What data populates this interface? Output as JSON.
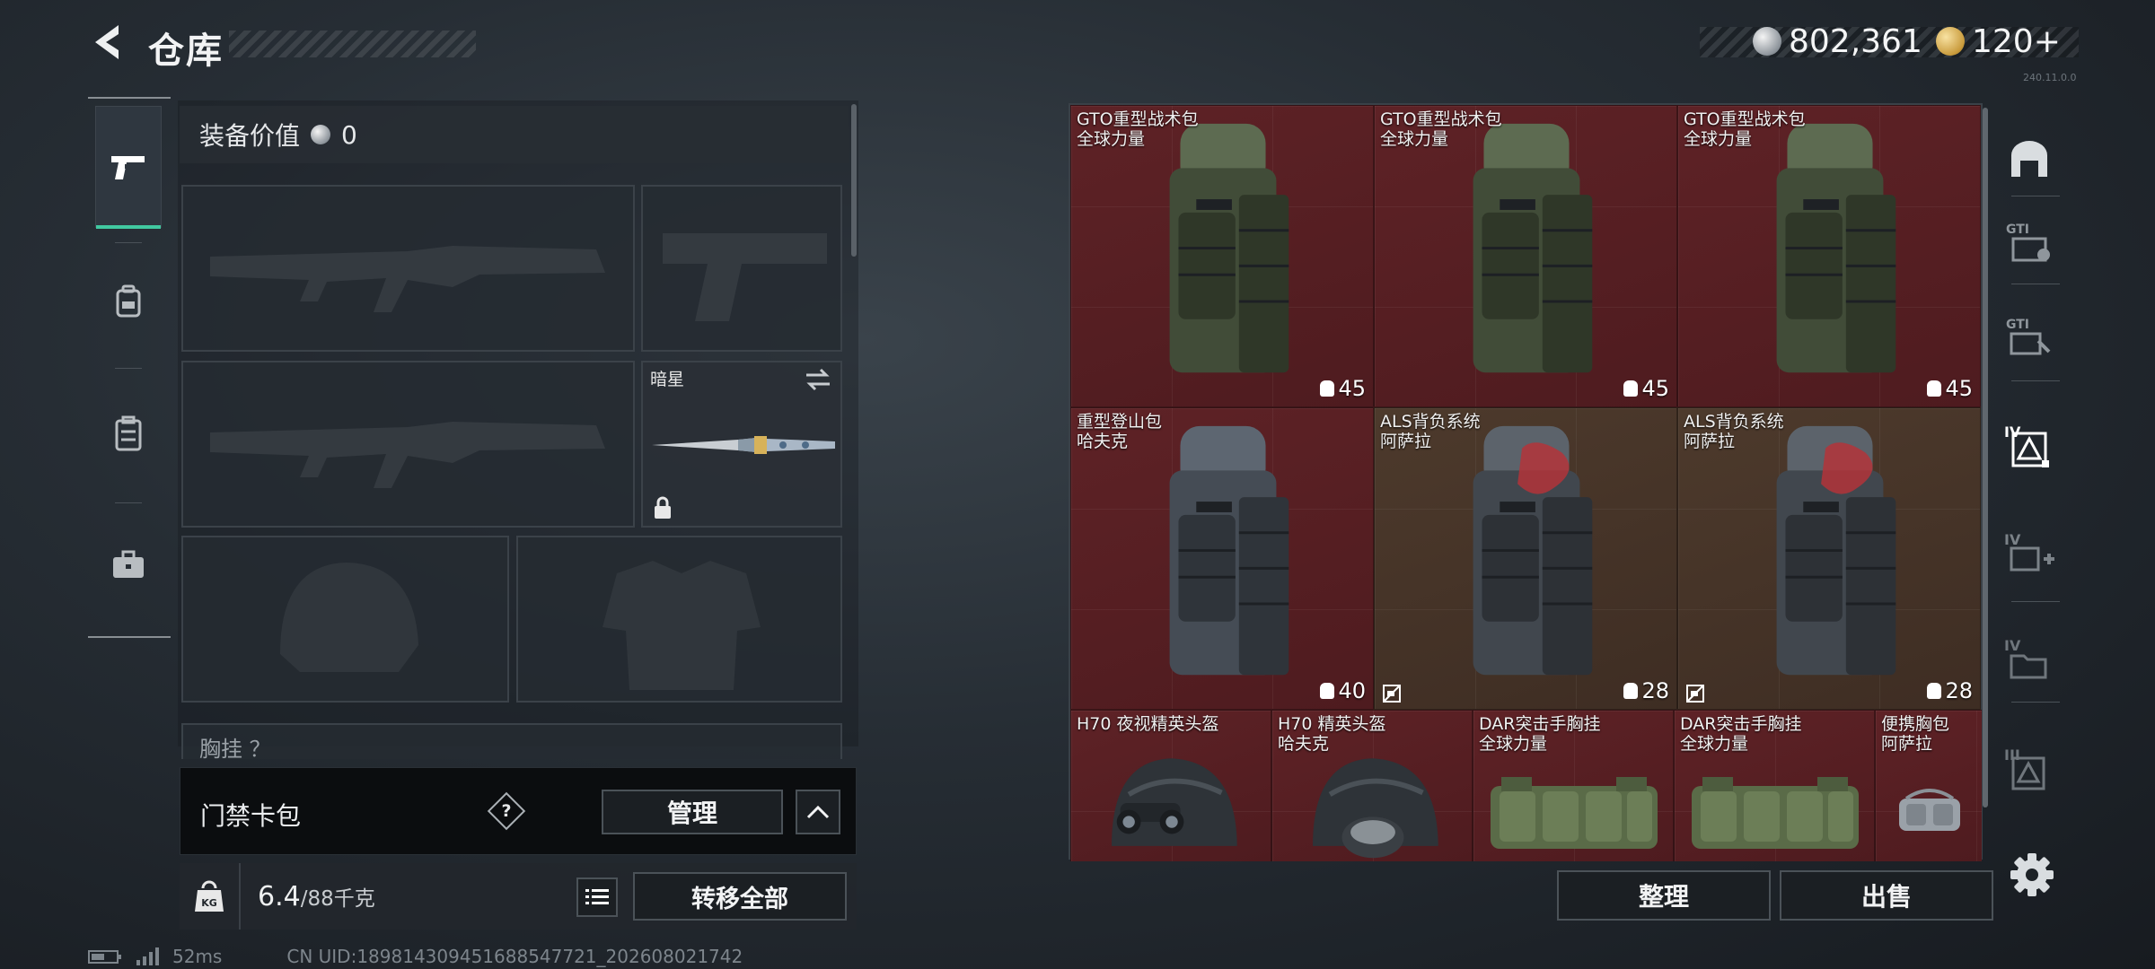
{
  "header": {
    "title": "仓库",
    "silver_amount": "802,361",
    "gold_amount": "120+",
    "version": "240.11.0.0"
  },
  "left_nav": {
    "items": [
      {
        "icon": "pistol-icon",
        "active": true
      },
      {
        "icon": "backpack-icon",
        "active": false
      },
      {
        "icon": "vest-icon",
        "active": false
      },
      {
        "icon": "briefcase-icon",
        "active": false
      }
    ]
  },
  "loadout": {
    "equip_value_label": "装备价值",
    "equip_value": "0",
    "melee_name": "暗星",
    "chest_label": "胸挂 ？"
  },
  "keycard": {
    "label": "门禁卡包",
    "help": "?",
    "manage_label": "管理"
  },
  "weight": {
    "current": "6.4",
    "max": "/88千克",
    "transfer_all_label": "转移全部",
    "kg_icon_text": "KG"
  },
  "status": {
    "ping": "52ms",
    "uid": "CN UID:189814309451688547721_202608021742"
  },
  "storage": {
    "items": [
      {
        "name": "GTO重型战术包",
        "brand": "全球力量",
        "capacity": "45",
        "color": "red",
        "kind": "pack-green",
        "no_sell": false
      },
      {
        "name": "GTO重型战术包",
        "brand": "全球力量",
        "capacity": "45",
        "color": "red",
        "kind": "pack-green",
        "no_sell": false
      },
      {
        "name": "GTO重型战术包",
        "brand": "全球力量",
        "capacity": "45",
        "color": "red",
        "kind": "pack-green",
        "no_sell": false
      },
      {
        "name": "重型登山包",
        "brand": "哈夫克",
        "capacity": "40",
        "color": "red",
        "kind": "pack-grey",
        "no_sell": false
      },
      {
        "name": "ALS背负系统",
        "brand": "阿萨拉",
        "capacity": "28",
        "color": "brown",
        "kind": "pack-red",
        "no_sell": true
      },
      {
        "name": "ALS背负系统",
        "brand": "阿萨拉",
        "capacity": "28",
        "color": "brown",
        "kind": "pack-red",
        "no_sell": true
      },
      {
        "name": "H70 夜视精英头盔",
        "brand": "",
        "capacity": "",
        "color": "red",
        "kind": "helmet-nv",
        "no_sell": false
      },
      {
        "name": "H70 精英头盔",
        "brand": "哈夫克",
        "capacity": "",
        "color": "red",
        "kind": "helmet",
        "no_sell": false
      },
      {
        "name": "DAR突击手胸挂",
        "brand": "全球力量",
        "capacity": "",
        "color": "red",
        "kind": "rig",
        "no_sell": false
      },
      {
        "name": "DAR突击手胸挂",
        "brand": "全球力量",
        "capacity": "",
        "color": "red",
        "kind": "rig",
        "no_sell": false
      },
      {
        "name": "便携胸包",
        "brand": "阿萨拉",
        "capacity": "",
        "color": "red",
        "kind": "pouch",
        "no_sell": false
      }
    ],
    "sort_label": "整理",
    "sell_label": "出售"
  },
  "right_nav": {
    "items": [
      {
        "icon": "storage-arch-icon"
      },
      {
        "icon": "gti-storage-1-icon"
      },
      {
        "icon": "gti-storage-2-icon"
      },
      {
        "icon": "tier4-storage-icon",
        "active": true
      },
      {
        "icon": "tier4-add-icon"
      },
      {
        "icon": "tier4-folder-icon"
      },
      {
        "icon": "tier3-storage-icon"
      }
    ]
  },
  "colors": {
    "accent": "#41c9a1",
    "item_red": "#5e2226",
    "item_brown": "#4d3a2c"
  }
}
